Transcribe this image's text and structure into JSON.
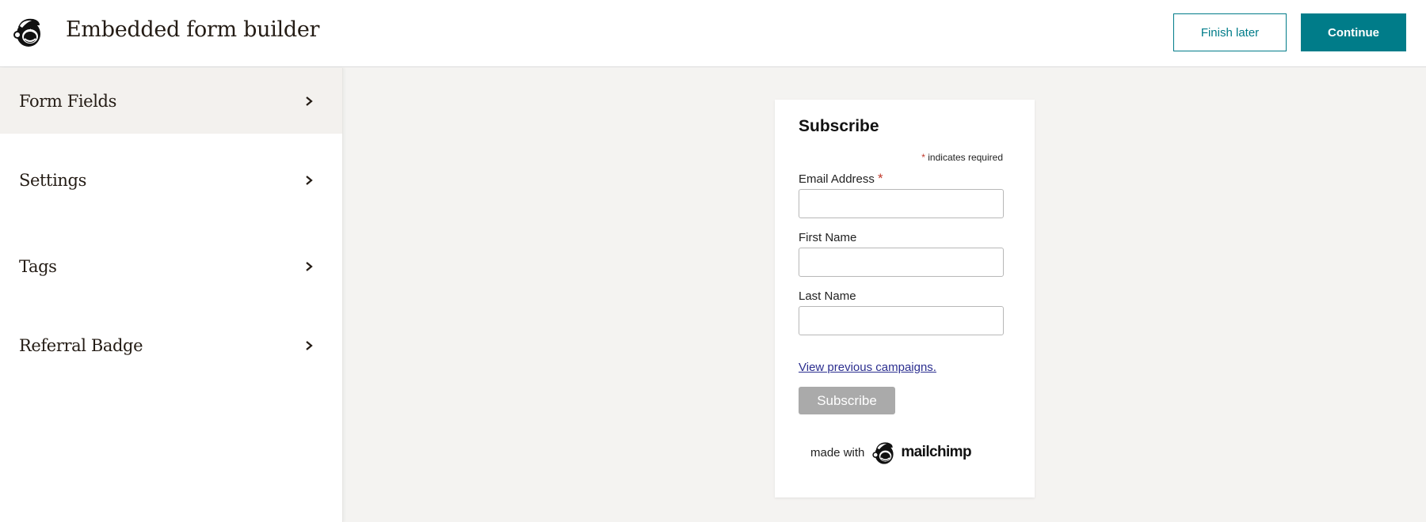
{
  "header": {
    "logo_icon": "mailchimp-freddie-icon",
    "title": "Embedded form builder",
    "finish_later_label": "Finish later",
    "continue_label": "Continue",
    "accent_color": "#007c89"
  },
  "sidebar": {
    "items": [
      {
        "label": "Form Fields",
        "active": true,
        "icon": "chevron-right-icon"
      },
      {
        "label": "Settings",
        "active": false,
        "icon": "chevron-right-icon"
      },
      {
        "label": "Tags",
        "active": false,
        "icon": "chevron-right-icon"
      },
      {
        "label": "Referral Badge",
        "active": false,
        "icon": "chevron-right-icon"
      }
    ]
  },
  "form_preview": {
    "title": "Subscribe",
    "required_marker": "*",
    "required_note": "indicates required",
    "fields": [
      {
        "label": "Email Address",
        "required": true,
        "value": "",
        "placeholder": ""
      },
      {
        "label": "First Name",
        "required": false,
        "value": "",
        "placeholder": ""
      },
      {
        "label": "Last Name",
        "required": false,
        "value": "",
        "placeholder": ""
      }
    ],
    "campaigns_link": "View previous campaigns.",
    "submit_label": "Subscribe",
    "made_with_text": "made with",
    "brand_wordmark": "mailchimp"
  }
}
